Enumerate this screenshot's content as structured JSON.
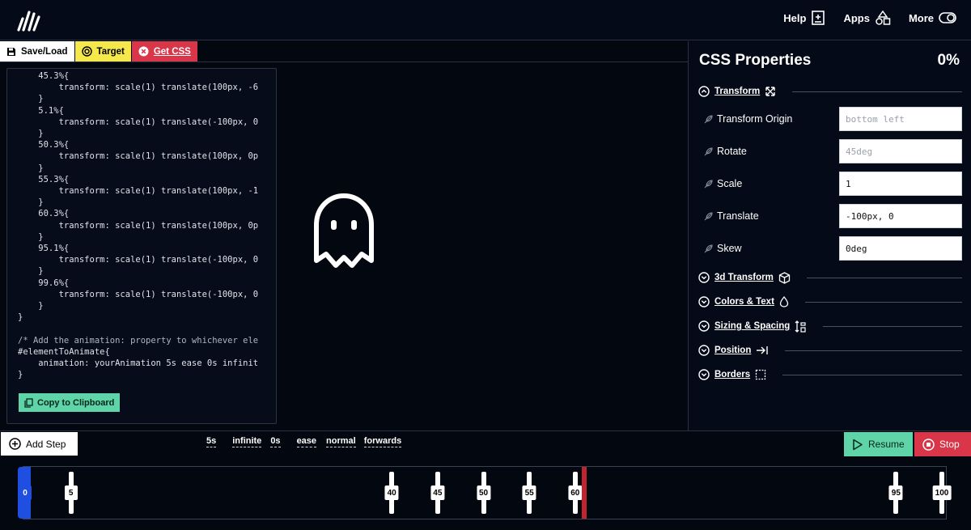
{
  "topnav": {
    "help": "Help",
    "apps": "Apps",
    "more": "More"
  },
  "toolbar": {
    "save_load": "Save/Load",
    "target": "Target",
    "get_css": "Get CSS"
  },
  "code": {
    "lines": [
      "    45.3%{",
      "        transform: scale(1) translate(100px, -6",
      "    }",
      "    5.1%{",
      "        transform: scale(1) translate(-100px, 0",
      "    }",
      "    50.3%{",
      "        transform: scale(1) translate(100px, 0p",
      "    }",
      "    55.3%{",
      "        transform: scale(1) translate(100px, -1",
      "    }",
      "    60.3%{",
      "        transform: scale(1) translate(100px, 0p",
      "    }",
      "    95.1%{",
      "        transform: scale(1) translate(-100px, 0",
      "    }",
      "    99.6%{",
      "        transform: scale(1) translate(-100px, 0",
      "    }",
      "}",
      "",
      "/* Add the animation: property to whichever ele",
      "#elementToAnimate{",
      "    animation: yourAnimation 5s ease 0s infinit",
      "}"
    ],
    "copy_label": "Copy to Clipboard"
  },
  "panel": {
    "title": "CSS Properties",
    "percent": "0%",
    "transform_section": "Transform",
    "props": [
      {
        "label": "Transform Origin",
        "placeholder": "bottom left",
        "value": ""
      },
      {
        "label": "Rotate",
        "placeholder": "45deg",
        "value": ""
      },
      {
        "label": "Scale",
        "placeholder": "",
        "value": "1"
      },
      {
        "label": "Translate",
        "placeholder": "",
        "value": "-100px, 0"
      },
      {
        "label": "Skew",
        "placeholder": "",
        "value": "0deg"
      }
    ],
    "sections": [
      "3d Transform",
      "Colors & Text",
      "Sizing & Spacing",
      "Position",
      "Borders"
    ]
  },
  "controls": {
    "add_step": "Add Step",
    "duration": "5s",
    "iterations": "infinite",
    "delay": "0s",
    "timing": "ease",
    "direction": "normal",
    "fill_mode": "forwards",
    "resume": "Resume",
    "stop": "Stop"
  },
  "timeline": {
    "keyframes": [
      "0",
      "5",
      "40",
      "45",
      "50",
      "55",
      "60",
      "95",
      "100"
    ],
    "playhead_percent": 61
  },
  "colors": {
    "accent_green": "#5fd4a8",
    "accent_red": "#d9364a",
    "accent_yellow": "#f4e84b",
    "accent_blue": "#1f4fe0"
  }
}
